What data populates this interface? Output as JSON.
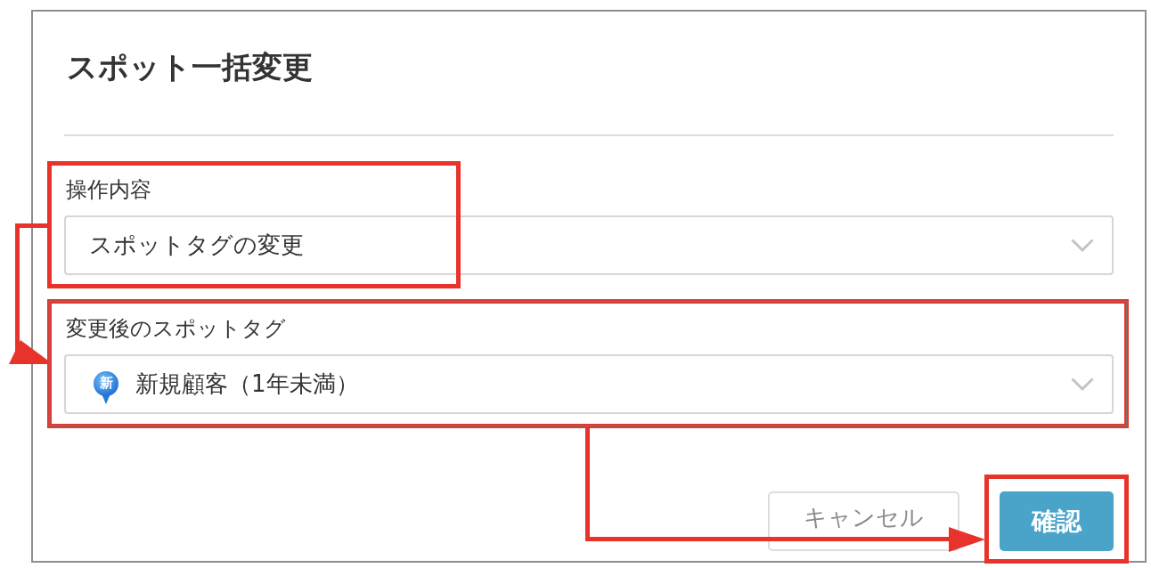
{
  "dialog": {
    "title": "スポット一括変更"
  },
  "fields": [
    {
      "label": "操作内容",
      "kind": "select",
      "value": "スポットタグの変更"
    },
    {
      "label": "変更後のスポットタグ",
      "kind": "tag-select",
      "value": "新規顧客（1年未満）",
      "tag_icon_label": "新"
    }
  ],
  "buttons": [
    {
      "label": "キャンセル",
      "kind": "secondary"
    },
    {
      "label": "確認",
      "kind": "primary"
    }
  ],
  "annotations": [
    {
      "kind": "highlight"
    },
    {
      "kind": "highlight"
    },
    {
      "kind": "highlight"
    },
    {
      "kind": "arrow"
    },
    {
      "kind": "arrow"
    }
  ]
}
